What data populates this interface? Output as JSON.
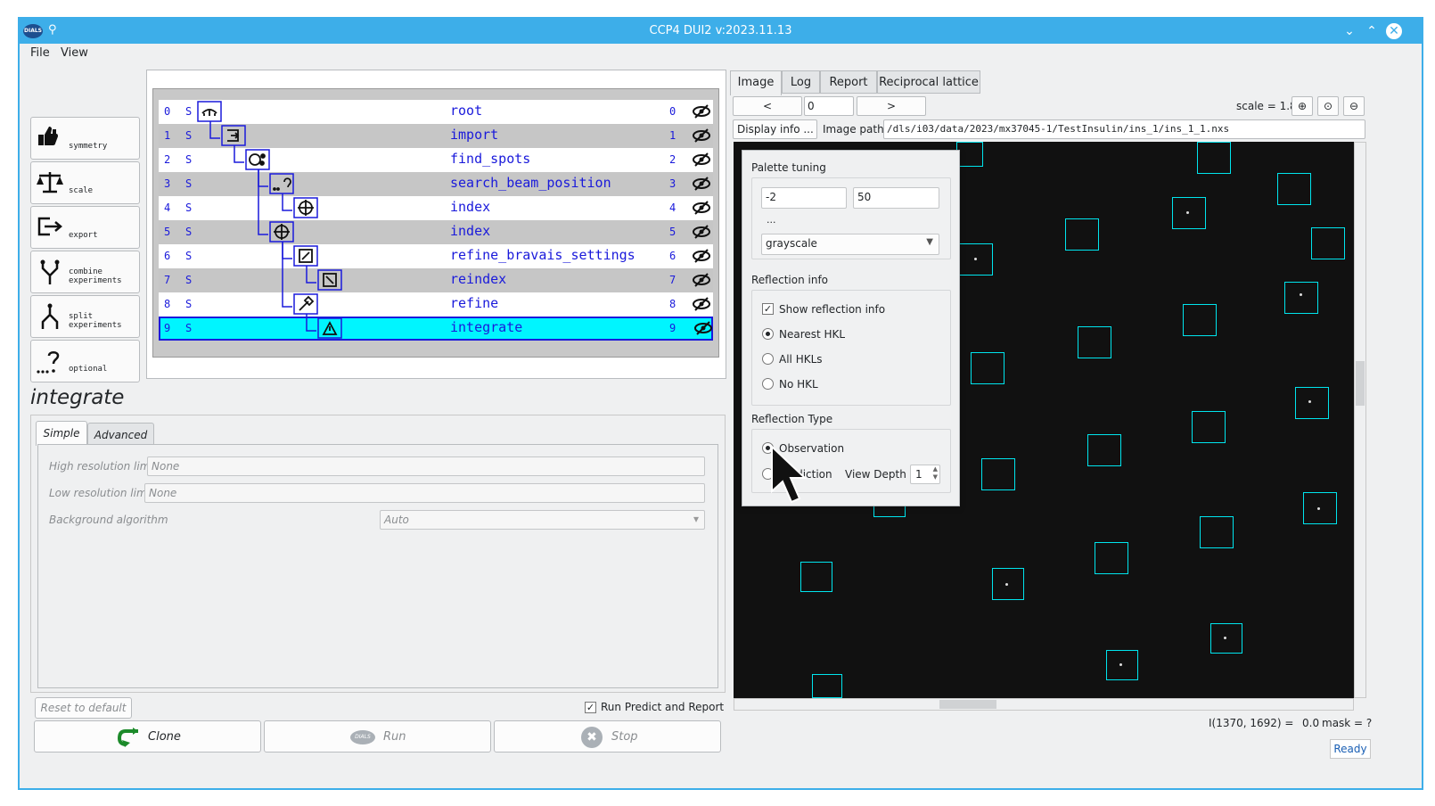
{
  "window": {
    "title": "CCP4 DUI2 v:2023.11.13",
    "app_icon_text": "DIALS"
  },
  "menu": [
    "File",
    "View"
  ],
  "side_buttons": [
    {
      "label": "symmetry",
      "icon": "thumbs-icon"
    },
    {
      "label": "scale",
      "icon": "balance-scale-icon"
    },
    {
      "label": "export",
      "icon": "export-icon"
    },
    {
      "label": "combine\nexperiments",
      "icon": "combine-icon"
    },
    {
      "label": "split\nexperiments",
      "icon": "split-icon"
    },
    {
      "label": "optional",
      "icon": "question-icon"
    }
  ],
  "tree": [
    {
      "num": "0",
      "status": "S",
      "name": "root"
    },
    {
      "num": "1",
      "status": "S",
      "name": "import"
    },
    {
      "num": "2",
      "status": "S",
      "name": "find_spots"
    },
    {
      "num": "3",
      "status": "S",
      "name": "search_beam_position"
    },
    {
      "num": "4",
      "status": "S",
      "name": "index"
    },
    {
      "num": "5",
      "status": "S",
      "name": "index"
    },
    {
      "num": "6",
      "status": "S",
      "name": "refine_bravais_settings"
    },
    {
      "num": "7",
      "status": "S",
      "name": "reindex"
    },
    {
      "num": "8",
      "status": "S",
      "name": "refine"
    },
    {
      "num": "9",
      "status": "S",
      "name": "integrate"
    }
  ],
  "current_step": "integrate",
  "param_tabs": [
    "Simple",
    "Advanced"
  ],
  "params": {
    "high_res_label": "High resolution limit",
    "high_res_placeholder": "None",
    "low_res_label": "Low resolution limit",
    "low_res_placeholder": "None",
    "bg_label": "Background algorithm",
    "bg_value": "Auto"
  },
  "bottom": {
    "reset": "Reset to default",
    "run_predict": "Run Predict and Report",
    "clone": "Clone",
    "run": "Run",
    "run_icon_text": "DIALS",
    "stop": "Stop"
  },
  "right_tabs": [
    "Image",
    "Log",
    "Report",
    "Reciprocal lattice"
  ],
  "image_nav": {
    "prev": "<",
    "frame": "0",
    "next": ">",
    "scale": "scale = 1.8"
  },
  "display_info": "Display info ...",
  "image_path_label": "Image path:",
  "image_path": "/dls/i03/data/2023/mx37045-1/TestInsulin/ins_1/ins_1_1.nxs",
  "popup": {
    "palette_title": "Palette tuning",
    "min": "-2",
    "max": "50",
    "ellipsis": "...",
    "palette": "grayscale",
    "refl_info_title": "Reflection info",
    "show_refl": "Show reflection info",
    "nearest": "Nearest HKL",
    "all": "All HKLs",
    "none": "No HKL",
    "refl_type_title": "Reflection Type",
    "observation": "Observation",
    "prediction": "Prediction",
    "depth_label": "View Depth",
    "depth": "1"
  },
  "status": {
    "pixel": "I(1370, 1692) =",
    "value": "0.0",
    "mask": "mask = ?",
    "ready": "Ready"
  },
  "colors": {
    "accent": "#3daee9",
    "tree_text": "#1a1adb",
    "selected_row": "#00f5ff",
    "box": "#00e5ee"
  }
}
